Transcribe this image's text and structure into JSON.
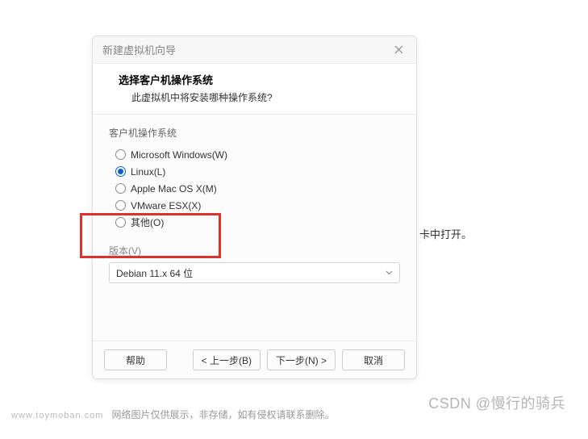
{
  "dialog": {
    "title": "新建虚拟机向导",
    "header": {
      "title": "选择客户机操作系统",
      "subtitle": "此虚拟机中将安装哪种操作系统?"
    },
    "os_group_label": "客户机操作系统",
    "os_options": [
      {
        "label": "Microsoft Windows(W)",
        "selected": false
      },
      {
        "label": "Linux(L)",
        "selected": true
      },
      {
        "label": "Apple Mac OS X(M)",
        "selected": false
      },
      {
        "label": "VMware ESX(X)",
        "selected": false
      },
      {
        "label": "其他(O)",
        "selected": false
      }
    ],
    "version_label": "版本(V)",
    "version_value": "Debian 11.x 64 位",
    "buttons": {
      "help": "帮助",
      "back": "< 上一步(B)",
      "next": "下一步(N) >",
      "cancel": "取消"
    }
  },
  "background_text": "卡中打开。",
  "watermark": "CSDN @慢行的骑兵",
  "footer_domain": "www.toymoban.com",
  "footer_note": "网络图片仅供展示，非存储，如有侵权请联系删除。"
}
